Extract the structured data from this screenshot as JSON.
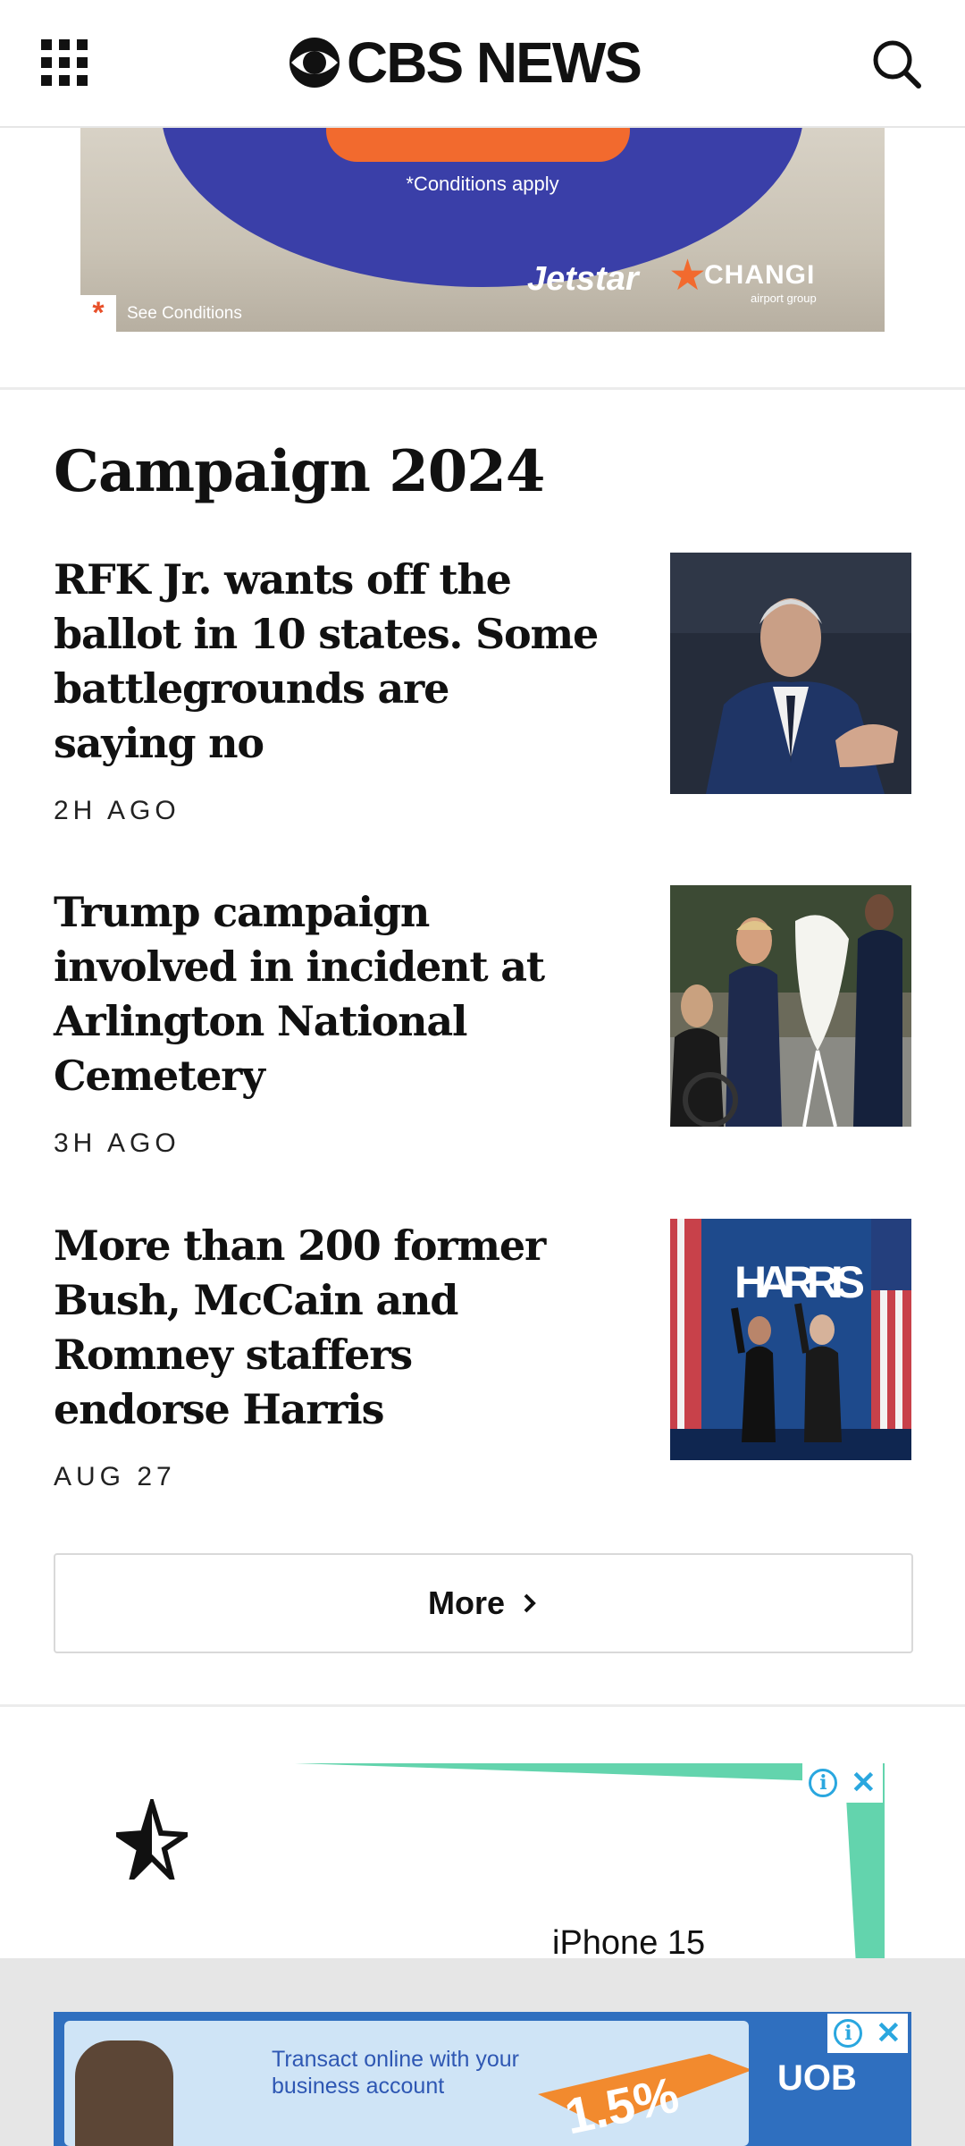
{
  "header": {
    "logo_text": "CBS NEWS"
  },
  "ad_top": {
    "conditions_text": "*Conditions apply",
    "brand_1": "Jetstar",
    "brand_2": "CHANGI",
    "brand_2_sub": "airport group",
    "see_conditions": "See Conditions",
    "colors": {
      "blob": "#3a3fa8",
      "accent": "#f26a2e"
    }
  },
  "section": {
    "title": "Campaign 2024",
    "stories": [
      {
        "headline": "RFK Jr. wants off the ballot in 10 states. Some battlegrounds are saying no",
        "time": "2H AGO"
      },
      {
        "headline": "Trump campaign involved in incident at Arlington National Cemetery",
        "time": "3H AGO"
      },
      {
        "headline": "More than 200 former Bush, McCain and Romney staffers endorse Harris",
        "time": "AUG 27",
        "thumb_sign": "HARRIS"
      }
    ],
    "more_label": "More"
  },
  "ad_middle": {
    "text": "iPhone 15",
    "accent": "#63d4ad"
  },
  "ad_bottom": {
    "text": "Transact online with your business account",
    "rate": "1.5%",
    "brand": "UOB"
  }
}
